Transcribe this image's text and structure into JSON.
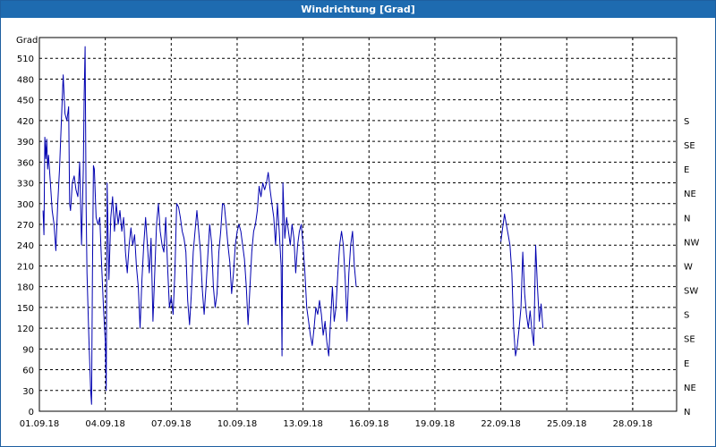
{
  "window": {
    "title": "Windrichtung [Grad]"
  },
  "chart_data": {
    "type": "line",
    "title": "Windrichtung [Grad]",
    "ylabel": "Grad",
    "xlabel": "",
    "ylim": [
      0,
      540
    ],
    "yticks": [
      0,
      30,
      60,
      90,
      120,
      150,
      180,
      210,
      240,
      270,
      300,
      330,
      360,
      390,
      420,
      450,
      480,
      510
    ],
    "xlim": [
      "2018-09-01",
      "2018-09-30"
    ],
    "xticks": [
      "01.09.18",
      "04.09.18",
      "07.09.18",
      "10.09.18",
      "13.09.18",
      "16.09.18",
      "19.09.18",
      "22.09.18",
      "25.09.18",
      "28.09.18"
    ],
    "right_axis_labels": [
      "N",
      "NE",
      "E",
      "SE",
      "S",
      "SW",
      "W",
      "NW",
      "N",
      "NE",
      "E",
      "SE",
      "S"
    ],
    "grid": true,
    "series": [
      {
        "color": "#0000b0",
        "segments": [
          [
            [
              "2018-09-01 04:00",
              290
            ],
            [
              "2018-09-01 05:00",
              255
            ],
            [
              "2018-09-01 06:00",
              396
            ],
            [
              "2018-09-01 07:00",
              365
            ],
            [
              "2018-09-01 08:00",
              393
            ],
            [
              "2018-09-01 09:00",
              350
            ],
            [
              "2018-09-01 10:00",
              370
            ],
            [
              "2018-09-01 12:00",
              330
            ],
            [
              "2018-09-01 14:00",
              290
            ],
            [
              "2018-09-01 16:00",
              270
            ],
            [
              "2018-09-01 18:00",
              232
            ],
            [
              "2018-09-01 20:00",
              300
            ],
            [
              "2018-09-01 22:00",
              350
            ],
            [
              "2018-09-02 00:00",
              420
            ],
            [
              "2018-09-02 02:00",
              486
            ],
            [
              "2018-09-02 04:00",
              430
            ],
            [
              "2018-09-02 06:00",
              420
            ],
            [
              "2018-09-02 08:00",
              440
            ],
            [
              "2018-09-02 09:00",
              300
            ],
            [
              "2018-09-02 10:00",
              290
            ],
            [
              "2018-09-02 12:00",
              330
            ],
            [
              "2018-09-02 14:00",
              340
            ],
            [
              "2018-09-02 16:00",
              320
            ],
            [
              "2018-09-02 18:00",
              310
            ],
            [
              "2018-09-02 20:00",
              360
            ],
            [
              "2018-09-02 22:00",
              240
            ],
            [
              "2018-09-03 00:00",
              350
            ],
            [
              "2018-09-03 01:00",
              460
            ],
            [
              "2018-09-03 02:00",
              527
            ],
            [
              "2018-09-03 03:00",
              300
            ],
            [
              "2018-09-03 04:00",
              200
            ],
            [
              "2018-09-03 06:00",
              110
            ],
            [
              "2018-09-03 08:00",
              30
            ],
            [
              "2018-09-03 09:00",
              10
            ],
            [
              "2018-09-03 10:00",
              200
            ],
            [
              "2018-09-03 11:00",
              355
            ],
            [
              "2018-09-03 12:00",
              350
            ],
            [
              "2018-09-03 14:00",
              280
            ],
            [
              "2018-09-03 16:00",
              270
            ],
            [
              "2018-09-03 18:00",
              280
            ],
            [
              "2018-09-03 20:00",
              210
            ],
            [
              "2018-09-03 22:00",
              150
            ],
            [
              "2018-09-04 00:00",
              100
            ],
            [
              "2018-09-04 01:00",
              30
            ],
            [
              "2018-09-04 02:00",
              330
            ],
            [
              "2018-09-04 04:00",
              190
            ],
            [
              "2018-09-04 06:00",
              280
            ],
            [
              "2018-09-04 08:00",
              310
            ],
            [
              "2018-09-04 10:00",
              260
            ],
            [
              "2018-09-04 12:00",
              300
            ],
            [
              "2018-09-04 14:00",
              270
            ],
            [
              "2018-09-04 16:00",
              290
            ],
            [
              "2018-09-04 18:00",
              260
            ],
            [
              "2018-09-04 20:00",
              280
            ],
            [
              "2018-09-04 22:00",
              230
            ],
            [
              "2018-09-05 00:00",
              200
            ],
            [
              "2018-09-05 02:00",
              240
            ],
            [
              "2018-09-05 04:00",
              265
            ],
            [
              "2018-09-05 06:00",
              240
            ],
            [
              "2018-09-05 08:00",
              255
            ],
            [
              "2018-09-05 10:00",
              210
            ],
            [
              "2018-09-05 12:00",
              180
            ],
            [
              "2018-09-05 14:00",
              120
            ],
            [
              "2018-09-05 16:00",
              190
            ],
            [
              "2018-09-05 18:00",
              240
            ],
            [
              "2018-09-05 20:00",
              280
            ],
            [
              "2018-09-05 22:00",
              240
            ],
            [
              "2018-09-06 00:00",
              200
            ],
            [
              "2018-09-06 02:00",
              250
            ],
            [
              "2018-09-06 04:00",
              130
            ],
            [
              "2018-09-06 06:00",
              200
            ],
            [
              "2018-09-06 08:00",
              270
            ],
            [
              "2018-09-06 10:00",
              300
            ],
            [
              "2018-09-06 12:00",
              260
            ],
            [
              "2018-09-06 14:00",
              240
            ],
            [
              "2018-09-06 16:00",
              230
            ],
            [
              "2018-09-06 18:00",
              280
            ],
            [
              "2018-09-06 20:00",
              210
            ],
            [
              "2018-09-06 22:00",
              150
            ],
            [
              "2018-09-07 00:00",
              165
            ],
            [
              "2018-09-07 02:00",
              140
            ],
            [
              "2018-09-07 04:00",
              200
            ],
            [
              "2018-09-07 06:00",
              300
            ],
            [
              "2018-09-07 08:00",
              295
            ],
            [
              "2018-09-07 10:00",
              280
            ],
            [
              "2018-09-07 12:00",
              260
            ],
            [
              "2018-09-07 14:00",
              250
            ],
            [
              "2018-09-07 16:00",
              230
            ],
            [
              "2018-09-07 18:00",
              160
            ],
            [
              "2018-09-07 20:00",
              125
            ],
            [
              "2018-09-07 22:00",
              170
            ],
            [
              "2018-09-08 00:00",
              230
            ],
            [
              "2018-09-08 02:00",
              260
            ],
            [
              "2018-09-08 04:00",
              290
            ],
            [
              "2018-09-08 06:00",
              260
            ],
            [
              "2018-09-08 08:00",
              230
            ],
            [
              "2018-09-08 10:00",
              175
            ],
            [
              "2018-09-08 12:00",
              140
            ],
            [
              "2018-09-08 14:00",
              180
            ],
            [
              "2018-09-08 16:00",
              225
            ],
            [
              "2018-09-08 18:00",
              270
            ],
            [
              "2018-09-08 20:00",
              245
            ],
            [
              "2018-09-08 22:00",
              180
            ],
            [
              "2018-09-09 00:00",
              150
            ],
            [
              "2018-09-09 02:00",
              170
            ],
            [
              "2018-09-09 04:00",
              230
            ],
            [
              "2018-09-09 06:00",
              260
            ],
            [
              "2018-09-09 08:00",
              300
            ],
            [
              "2018-09-09 10:00",
              298
            ],
            [
              "2018-09-09 12:00",
              270
            ],
            [
              "2018-09-09 14:00",
              240
            ],
            [
              "2018-09-09 16:00",
              215
            ],
            [
              "2018-09-09 18:00",
              170
            ],
            [
              "2018-09-09 20:00",
              200
            ],
            [
              "2018-09-09 22:00",
              240
            ],
            [
              "2018-09-10 00:00",
              260
            ],
            [
              "2018-09-10 02:00",
              270
            ],
            [
              "2018-09-10 04:00",
              260
            ],
            [
              "2018-09-10 06:00",
              240
            ],
            [
              "2018-09-10 08:00",
              220
            ],
            [
              "2018-09-10 10:00",
              180
            ],
            [
              "2018-09-10 12:00",
              125
            ],
            [
              "2018-09-10 14:00",
              180
            ],
            [
              "2018-09-10 16:00",
              230
            ],
            [
              "2018-09-10 18:00",
              260
            ],
            [
              "2018-09-10 20:00",
              270
            ],
            [
              "2018-09-10 22:00",
              290
            ],
            [
              "2018-09-11 00:00",
              325
            ],
            [
              "2018-09-11 02:00",
              310
            ],
            [
              "2018-09-11 04:00",
              330
            ],
            [
              "2018-09-11 06:00",
              320
            ],
            [
              "2018-09-11 08:00",
              330
            ],
            [
              "2018-09-11 10:00",
              345
            ],
            [
              "2018-09-11 12:00",
              320
            ],
            [
              "2018-09-11 14:00",
              300
            ],
            [
              "2018-09-11 16:00",
              280
            ],
            [
              "2018-09-11 18:00",
              240
            ],
            [
              "2018-09-11 20:00",
              300
            ],
            [
              "2018-09-11 22:00",
              260
            ],
            [
              "2018-09-12 00:00",
              210
            ],
            [
              "2018-09-12 01:00",
              80
            ],
            [
              "2018-09-12 02:00",
              330
            ],
            [
              "2018-09-12 04:00",
              250
            ],
            [
              "2018-09-12 06:00",
              280
            ],
            [
              "2018-09-12 08:00",
              260
            ],
            [
              "2018-09-12 10:00",
              240
            ],
            [
              "2018-09-12 12:00",
              270
            ],
            [
              "2018-09-12 14:00",
              250
            ],
            [
              "2018-09-12 16:00",
              200
            ],
            [
              "2018-09-12 18:00",
              240
            ],
            [
              "2018-09-12 20:00",
              260
            ],
            [
              "2018-09-12 22:00",
              270
            ],
            [
              "2018-09-13 00:00",
              240
            ],
            [
              "2018-09-13 02:00",
              200
            ],
            [
              "2018-09-13 04:00",
              150
            ],
            [
              "2018-09-13 06:00",
              130
            ],
            [
              "2018-09-13 08:00",
              110
            ],
            [
              "2018-09-13 10:00",
              95
            ],
            [
              "2018-09-13 12:00",
              120
            ],
            [
              "2018-09-13 14:00",
              150
            ],
            [
              "2018-09-13 16:00",
              140
            ],
            [
              "2018-09-13 18:00",
              160
            ],
            [
              "2018-09-13 20:00",
              140
            ],
            [
              "2018-09-13 22:00",
              110
            ],
            [
              "2018-09-14 00:00",
              130
            ],
            [
              "2018-09-14 02:00",
              100
            ],
            [
              "2018-09-14 04:00",
              80
            ],
            [
              "2018-09-14 06:00",
              130
            ],
            [
              "2018-09-14 08:00",
              180
            ],
            [
              "2018-09-14 10:00",
              130
            ],
            [
              "2018-09-14 12:00",
              150
            ],
            [
              "2018-09-14 14:00",
              200
            ],
            [
              "2018-09-14 16:00",
              240
            ],
            [
              "2018-09-14 18:00",
              260
            ],
            [
              "2018-09-14 20:00",
              240
            ],
            [
              "2018-09-14 22:00",
              190
            ],
            [
              "2018-09-15 00:00",
              130
            ],
            [
              "2018-09-15 02:00",
              200
            ],
            [
              "2018-09-15 04:00",
              240
            ],
            [
              "2018-09-15 06:00",
              260
            ],
            [
              "2018-09-15 08:00",
              210
            ],
            [
              "2018-09-15 10:00",
              180
            ]
          ],
          [
            [
              "2018-09-22 00:00",
              245
            ],
            [
              "2018-09-22 02:00",
              265
            ],
            [
              "2018-09-22 04:00",
              285
            ],
            [
              "2018-09-22 06:00",
              270
            ],
            [
              "2018-09-22 08:00",
              255
            ],
            [
              "2018-09-22 10:00",
              240
            ],
            [
              "2018-09-22 12:00",
              200
            ],
            [
              "2018-09-22 14:00",
              120
            ],
            [
              "2018-09-22 16:00",
              80
            ],
            [
              "2018-09-22 18:00",
              95
            ],
            [
              "2018-09-22 20:00",
              120
            ],
            [
              "2018-09-22 22:00",
              150
            ],
            [
              "2018-09-23 00:00",
              230
            ],
            [
              "2018-09-23 02:00",
              170
            ],
            [
              "2018-09-23 04:00",
              140
            ],
            [
              "2018-09-23 06:00",
              120
            ],
            [
              "2018-09-23 08:00",
              145
            ],
            [
              "2018-09-23 10:00",
              115
            ],
            [
              "2018-09-23 12:00",
              95
            ],
            [
              "2018-09-23 14:00",
              240
            ],
            [
              "2018-09-23 16:00",
              180
            ],
            [
              "2018-09-23 18:00",
              130
            ],
            [
              "2018-09-23 20:00",
              155
            ],
            [
              "2018-09-23 22:00",
              120
            ]
          ]
        ]
      }
    ]
  }
}
